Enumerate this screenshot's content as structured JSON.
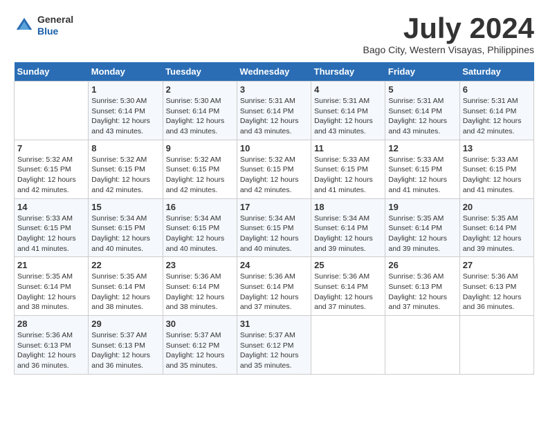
{
  "logo": {
    "line1": "General",
    "line2": "Blue"
  },
  "header": {
    "month": "July 2024",
    "location": "Bago City, Western Visayas, Philippines"
  },
  "weekdays": [
    "Sunday",
    "Monday",
    "Tuesday",
    "Wednesday",
    "Thursday",
    "Friday",
    "Saturday"
  ],
  "weeks": [
    [
      {
        "day": "",
        "sunrise": "",
        "sunset": "",
        "daylight": ""
      },
      {
        "day": "1",
        "sunrise": "Sunrise: 5:30 AM",
        "sunset": "Sunset: 6:14 PM",
        "daylight": "Daylight: 12 hours and 43 minutes."
      },
      {
        "day": "2",
        "sunrise": "Sunrise: 5:30 AM",
        "sunset": "Sunset: 6:14 PM",
        "daylight": "Daylight: 12 hours and 43 minutes."
      },
      {
        "day": "3",
        "sunrise": "Sunrise: 5:31 AM",
        "sunset": "Sunset: 6:14 PM",
        "daylight": "Daylight: 12 hours and 43 minutes."
      },
      {
        "day": "4",
        "sunrise": "Sunrise: 5:31 AM",
        "sunset": "Sunset: 6:14 PM",
        "daylight": "Daylight: 12 hours and 43 minutes."
      },
      {
        "day": "5",
        "sunrise": "Sunrise: 5:31 AM",
        "sunset": "Sunset: 6:14 PM",
        "daylight": "Daylight: 12 hours and 43 minutes."
      },
      {
        "day": "6",
        "sunrise": "Sunrise: 5:31 AM",
        "sunset": "Sunset: 6:14 PM",
        "daylight": "Daylight: 12 hours and 42 minutes."
      }
    ],
    [
      {
        "day": "7",
        "sunrise": "Sunrise: 5:32 AM",
        "sunset": "Sunset: 6:15 PM",
        "daylight": "Daylight: 12 hours and 42 minutes."
      },
      {
        "day": "8",
        "sunrise": "Sunrise: 5:32 AM",
        "sunset": "Sunset: 6:15 PM",
        "daylight": "Daylight: 12 hours and 42 minutes."
      },
      {
        "day": "9",
        "sunrise": "Sunrise: 5:32 AM",
        "sunset": "Sunset: 6:15 PM",
        "daylight": "Daylight: 12 hours and 42 minutes."
      },
      {
        "day": "10",
        "sunrise": "Sunrise: 5:32 AM",
        "sunset": "Sunset: 6:15 PM",
        "daylight": "Daylight: 12 hours and 42 minutes."
      },
      {
        "day": "11",
        "sunrise": "Sunrise: 5:33 AM",
        "sunset": "Sunset: 6:15 PM",
        "daylight": "Daylight: 12 hours and 41 minutes."
      },
      {
        "day": "12",
        "sunrise": "Sunrise: 5:33 AM",
        "sunset": "Sunset: 6:15 PM",
        "daylight": "Daylight: 12 hours and 41 minutes."
      },
      {
        "day": "13",
        "sunrise": "Sunrise: 5:33 AM",
        "sunset": "Sunset: 6:15 PM",
        "daylight": "Daylight: 12 hours and 41 minutes."
      }
    ],
    [
      {
        "day": "14",
        "sunrise": "Sunrise: 5:33 AM",
        "sunset": "Sunset: 6:15 PM",
        "daylight": "Daylight: 12 hours and 41 minutes."
      },
      {
        "day": "15",
        "sunrise": "Sunrise: 5:34 AM",
        "sunset": "Sunset: 6:15 PM",
        "daylight": "Daylight: 12 hours and 40 minutes."
      },
      {
        "day": "16",
        "sunrise": "Sunrise: 5:34 AM",
        "sunset": "Sunset: 6:15 PM",
        "daylight": "Daylight: 12 hours and 40 minutes."
      },
      {
        "day": "17",
        "sunrise": "Sunrise: 5:34 AM",
        "sunset": "Sunset: 6:15 PM",
        "daylight": "Daylight: 12 hours and 40 minutes."
      },
      {
        "day": "18",
        "sunrise": "Sunrise: 5:34 AM",
        "sunset": "Sunset: 6:14 PM",
        "daylight": "Daylight: 12 hours and 39 minutes."
      },
      {
        "day": "19",
        "sunrise": "Sunrise: 5:35 AM",
        "sunset": "Sunset: 6:14 PM",
        "daylight": "Daylight: 12 hours and 39 minutes."
      },
      {
        "day": "20",
        "sunrise": "Sunrise: 5:35 AM",
        "sunset": "Sunset: 6:14 PM",
        "daylight": "Daylight: 12 hours and 39 minutes."
      }
    ],
    [
      {
        "day": "21",
        "sunrise": "Sunrise: 5:35 AM",
        "sunset": "Sunset: 6:14 PM",
        "daylight": "Daylight: 12 hours and 38 minutes."
      },
      {
        "day": "22",
        "sunrise": "Sunrise: 5:35 AM",
        "sunset": "Sunset: 6:14 PM",
        "daylight": "Daylight: 12 hours and 38 minutes."
      },
      {
        "day": "23",
        "sunrise": "Sunrise: 5:36 AM",
        "sunset": "Sunset: 6:14 PM",
        "daylight": "Daylight: 12 hours and 38 minutes."
      },
      {
        "day": "24",
        "sunrise": "Sunrise: 5:36 AM",
        "sunset": "Sunset: 6:14 PM",
        "daylight": "Daylight: 12 hours and 37 minutes."
      },
      {
        "day": "25",
        "sunrise": "Sunrise: 5:36 AM",
        "sunset": "Sunset: 6:14 PM",
        "daylight": "Daylight: 12 hours and 37 minutes."
      },
      {
        "day": "26",
        "sunrise": "Sunrise: 5:36 AM",
        "sunset": "Sunset: 6:13 PM",
        "daylight": "Daylight: 12 hours and 37 minutes."
      },
      {
        "day": "27",
        "sunrise": "Sunrise: 5:36 AM",
        "sunset": "Sunset: 6:13 PM",
        "daylight": "Daylight: 12 hours and 36 minutes."
      }
    ],
    [
      {
        "day": "28",
        "sunrise": "Sunrise: 5:36 AM",
        "sunset": "Sunset: 6:13 PM",
        "daylight": "Daylight: 12 hours and 36 minutes."
      },
      {
        "day": "29",
        "sunrise": "Sunrise: 5:37 AM",
        "sunset": "Sunset: 6:13 PM",
        "daylight": "Daylight: 12 hours and 36 minutes."
      },
      {
        "day": "30",
        "sunrise": "Sunrise: 5:37 AM",
        "sunset": "Sunset: 6:12 PM",
        "daylight": "Daylight: 12 hours and 35 minutes."
      },
      {
        "day": "31",
        "sunrise": "Sunrise: 5:37 AM",
        "sunset": "Sunset: 6:12 PM",
        "daylight": "Daylight: 12 hours and 35 minutes."
      },
      {
        "day": "",
        "sunrise": "",
        "sunset": "",
        "daylight": ""
      },
      {
        "day": "",
        "sunrise": "",
        "sunset": "",
        "daylight": ""
      },
      {
        "day": "",
        "sunrise": "",
        "sunset": "",
        "daylight": ""
      }
    ]
  ]
}
